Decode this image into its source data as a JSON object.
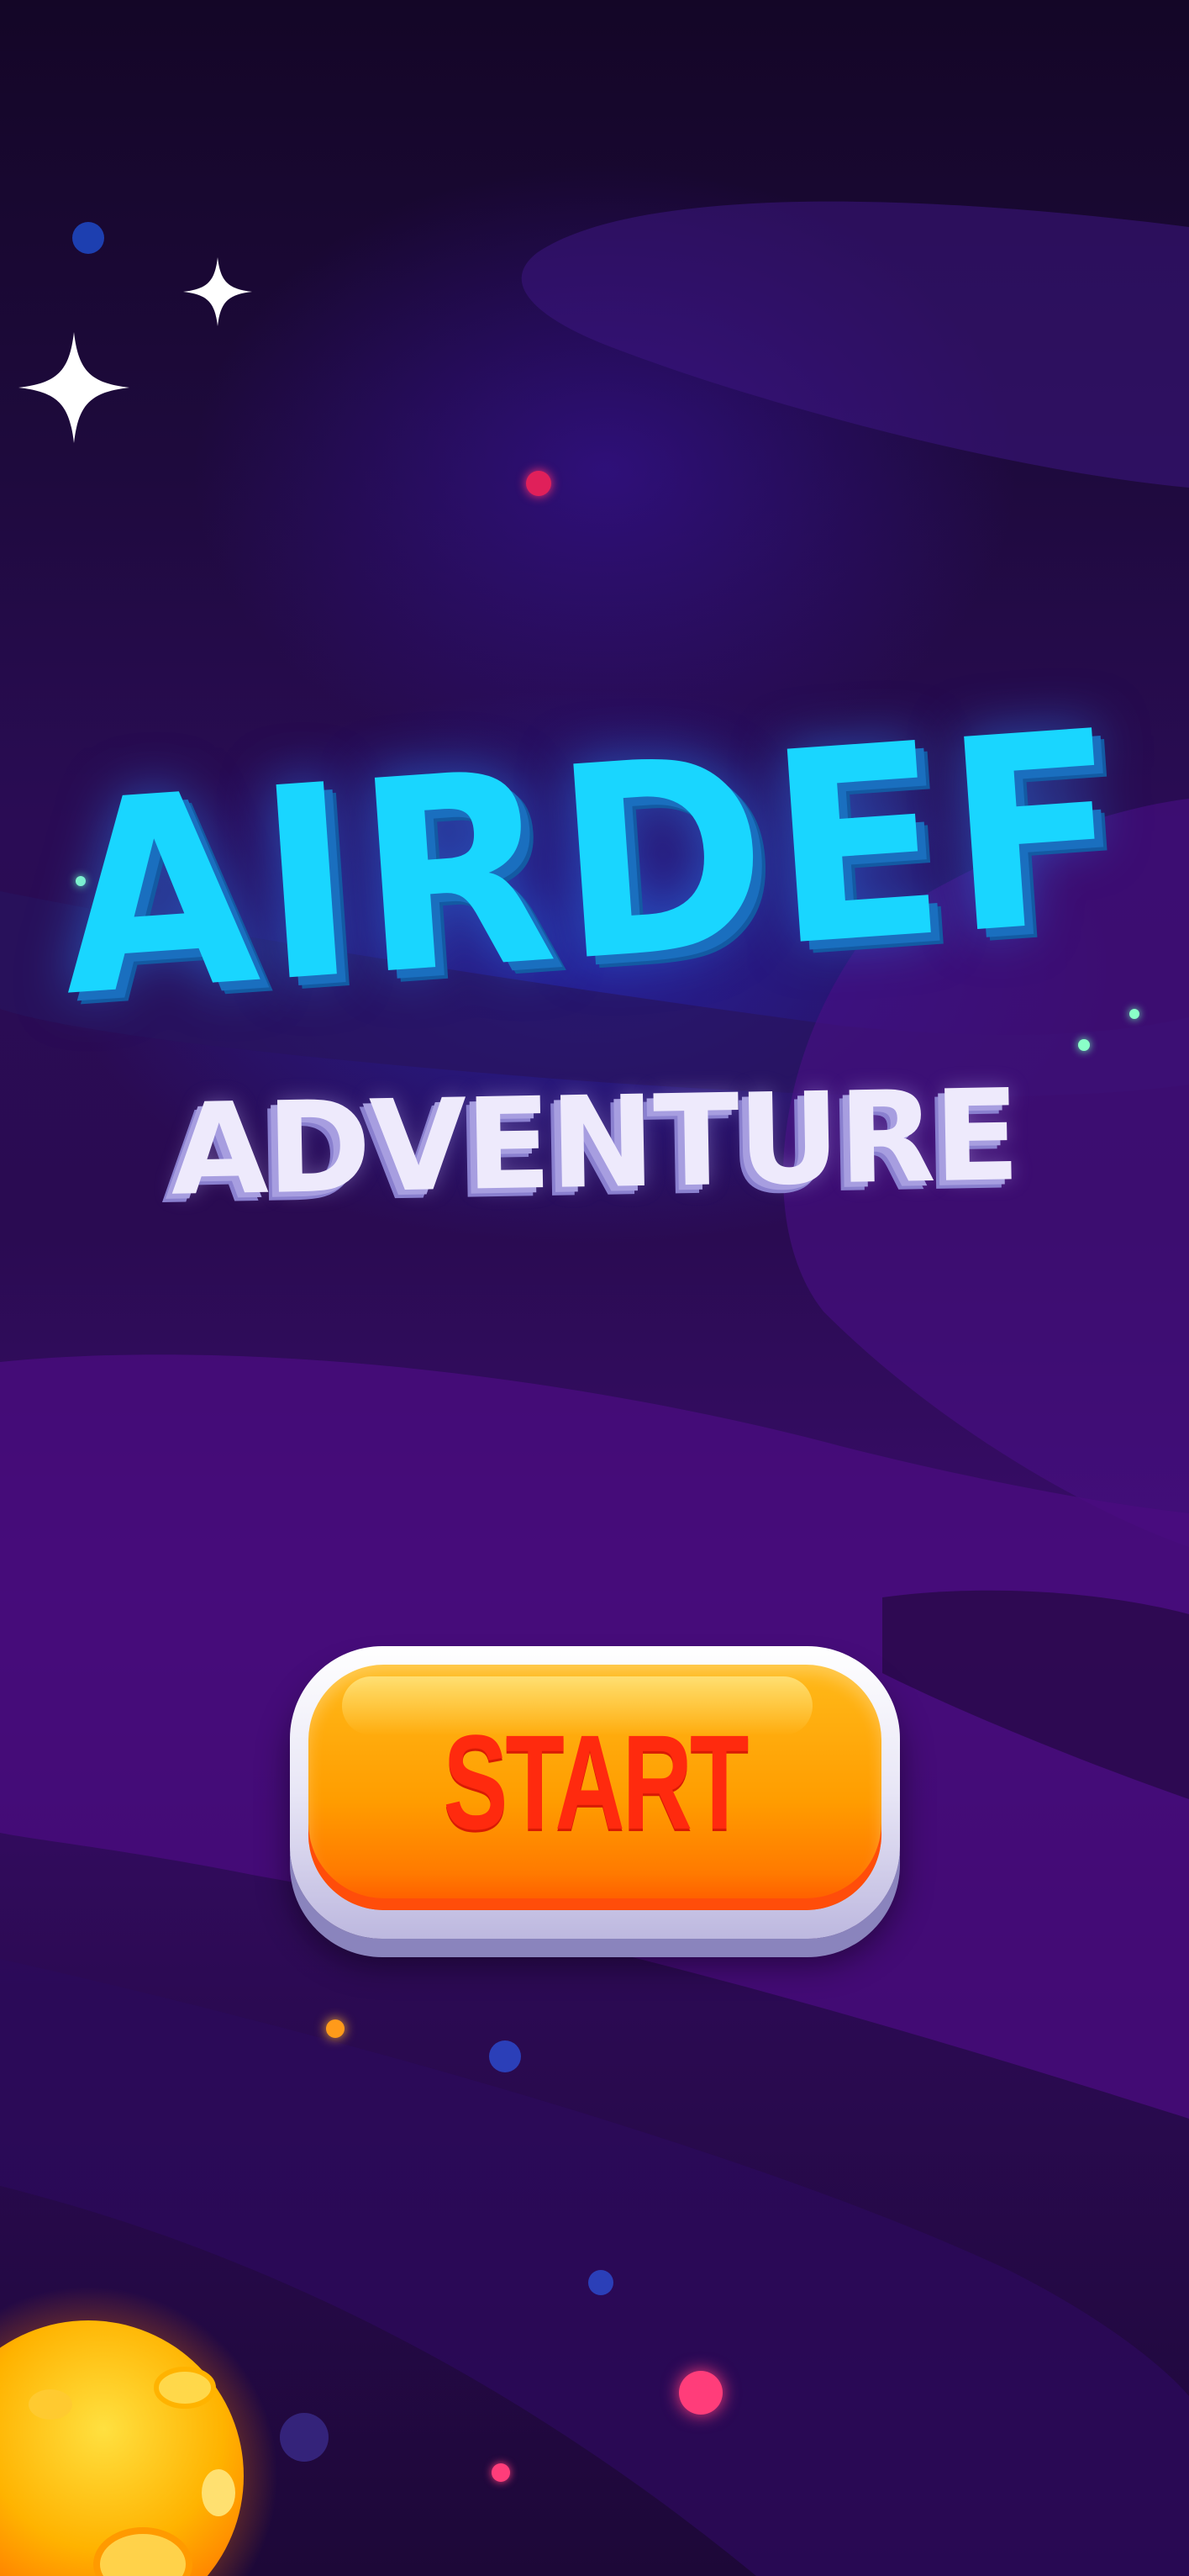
{
  "game": {
    "title": "AIRDEF",
    "subtitle": "ADVENTURE",
    "start_label": "START"
  },
  "colors": {
    "background_top": "#140627",
    "background_mid": "#3a0d6b",
    "title_cyan": "#19d6ff",
    "title_shadow": "#1a6fbf",
    "subtitle_white": "#eeeafc",
    "button_orange": "#ff9d00",
    "button_text_red": "#ff2a0e",
    "planet_orange": "#ffb300"
  },
  "icons": {
    "large_star": "four-point-sparkle",
    "small_star": "four-point-sparkle",
    "planet": "lava-planet"
  }
}
